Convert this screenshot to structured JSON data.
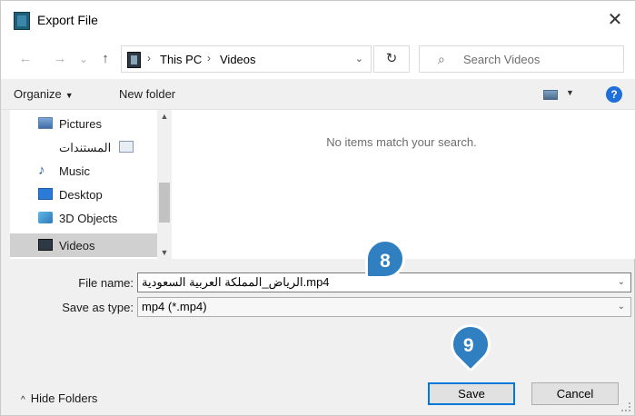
{
  "window": {
    "title": "Export File",
    "close_glyph": "✕"
  },
  "nav": {
    "back": "←",
    "forward": "→",
    "recent": "⌄",
    "up": "↑"
  },
  "address": {
    "crumbs": [
      "This PC",
      "Videos"
    ],
    "separator": "›",
    "dropdown": "⌄"
  },
  "refresh_glyph": "↻",
  "search": {
    "placeholder": "Search Videos",
    "icon": "⌕"
  },
  "toolbar": {
    "organize": "Organize",
    "organize_caret": "▼",
    "new_folder": "New folder",
    "view_caret": "▼",
    "help": "?"
  },
  "sidebar": {
    "items": [
      {
        "label": "Pictures",
        "icon": "pictures-icon"
      },
      {
        "label": "المستندات",
        "icon": "documents-icon"
      },
      {
        "label": "Music",
        "icon": "music-icon"
      },
      {
        "label": "Desktop",
        "icon": "desktop-icon"
      },
      {
        "label": "3D Objects",
        "icon": "3d-objects-icon"
      },
      {
        "label": "Videos",
        "icon": "videos-icon",
        "selected": true
      }
    ],
    "scroll_up": "▲",
    "scroll_down": "▼"
  },
  "filelist": {
    "empty_message": "No items match your search."
  },
  "form": {
    "file_name_label": "File name:",
    "file_name_value": "الرياض_المملكة العربية السعودية.mp4",
    "save_as_type_label": "Save as type:",
    "save_as_type_value": "mp4 (*.mp4)",
    "caret": "⌄"
  },
  "callouts": {
    "step8": "8",
    "step9": "9"
  },
  "buttons": {
    "save": "Save",
    "cancel": "Cancel",
    "hide_folders": "Hide Folders",
    "hide_folders_chevron": "^"
  },
  "colors": {
    "accent": "#0078d7",
    "callout": "#2f7fc1",
    "selected_row": "#d0d0d0"
  }
}
